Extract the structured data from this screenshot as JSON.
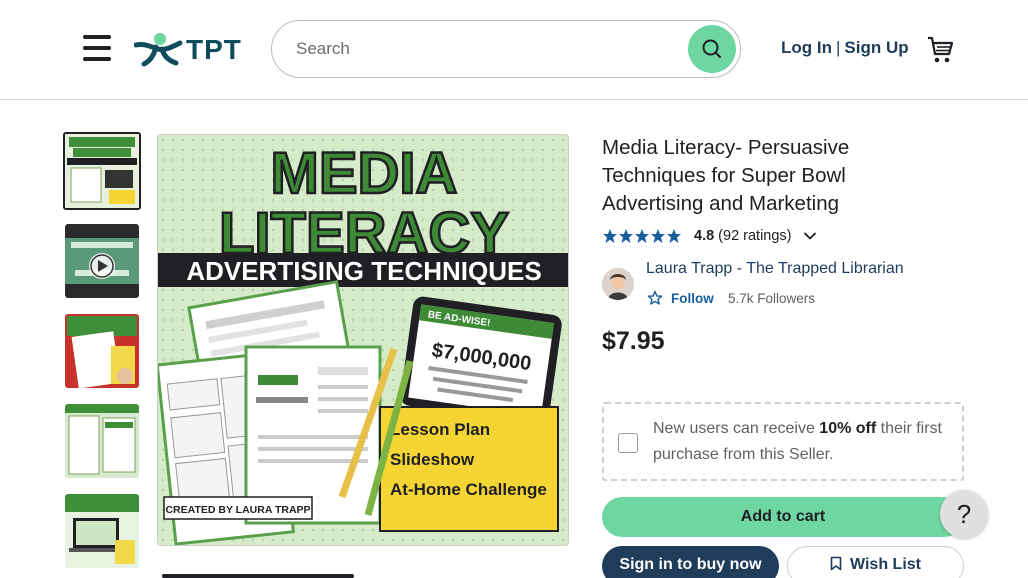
{
  "header": {
    "menu_icon": "hamburger-menu-icon",
    "logo_text": "TPT",
    "search_placeholder": "Search",
    "search_icon": "search-icon",
    "login_label": "Log In",
    "separator": "|",
    "signup_label": "Sign Up",
    "cart_icon": "shopping-cart-icon"
  },
  "gallery": {
    "thumbnails": [
      {
        "kind": "image",
        "active": true
      },
      {
        "kind": "video",
        "icon": "play-icon"
      },
      {
        "kind": "image"
      },
      {
        "kind": "image"
      },
      {
        "kind": "image"
      }
    ],
    "cover": {
      "line1": "MEDIA",
      "line2": "LITERACY",
      "banner": "ADVERTISING TECHNIQUES",
      "tablet_price": "$7,000,000",
      "tablet_heading": "BE AD-WISE!",
      "items": [
        "Lesson Plan",
        "Slideshow",
        "At-Home Challenge"
      ],
      "credit": "CREATED BY LAURA TRAPP"
    }
  },
  "product": {
    "title": "Media Literacy- Persuasive Techniques for Super Bowl Advertising and Marketing",
    "rating": 4.8,
    "rating_label": "4.8",
    "rating_count": "(92 ratings)",
    "stars": 5,
    "seller_name": "Laura Trapp - The Trapped Librarian",
    "follow_label": "Follow",
    "followers": "5.7k Followers",
    "price": "$7.95",
    "promo_prefix": "New users can receive ",
    "promo_highlight": "10% off",
    "promo_suffix": " their first purchase from this Seller.",
    "add_to_cart": "Add to cart",
    "sign_in_buy": "Sign in to buy now",
    "wish_list": "Wish List",
    "help_label": "?"
  },
  "colors": {
    "accent_green": "#6ed6a3",
    "navy": "#1f3c5a",
    "link_blue": "#1a5fa0",
    "star_blue": "#1a5fa0"
  }
}
